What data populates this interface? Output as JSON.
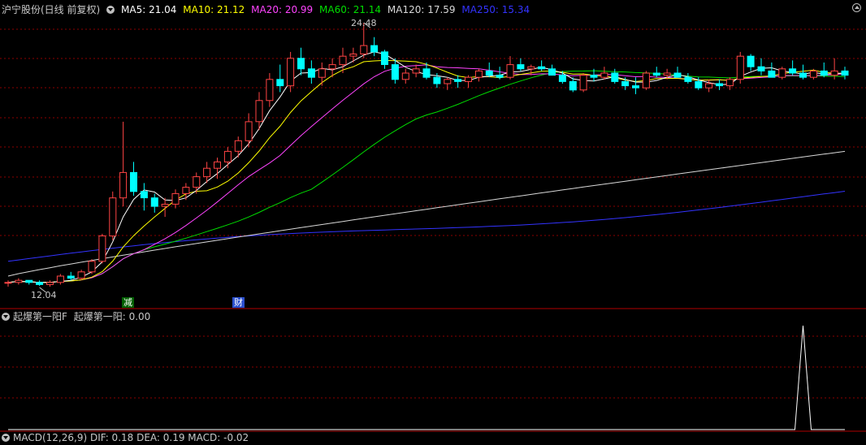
{
  "main_legend": {
    "title": "沪宁股份(日线 前复权)",
    "ma5": "MA5: 21.04",
    "ma10": "MA10: 21.12",
    "ma20": "MA20: 20.99",
    "ma60": "MA60: 21.14",
    "ma120": "MA120: 17.59",
    "ma250": "MA250: 15.34"
  },
  "colors": {
    "ma5": "#ffffff",
    "ma10": "#ffff00",
    "ma20": "#ff44ff",
    "ma60": "#00dd00",
    "ma120": "#d8d8d8",
    "ma250": "#3333ff",
    "up": "#ff4444",
    "down": "#00ffff",
    "grid": "#8b0000",
    "tag_green": "#00c000",
    "tag_blue": "#4a7bff"
  },
  "annotations": {
    "high": "24.48",
    "low": "12.04"
  },
  "event_tags": [
    "减",
    "财"
  ],
  "indicator_legend": {
    "name": "起爆第一阳F",
    "value": "起爆第一阳: 0.00"
  },
  "macd_legend": {
    "text": "MACD(12,26,9)  DIF: 0.18  DEA: 0.19  MACD: -0.02"
  },
  "chart_data": {
    "type": "candlestick",
    "price_range": [
      12.04,
      24.48
    ],
    "candles": [
      [
        12.2,
        12.3,
        12.0,
        12.2
      ],
      [
        12.2,
        12.4,
        12.1,
        12.3
      ],
      [
        12.3,
        12.3,
        12.1,
        12.2
      ],
      [
        12.2,
        12.3,
        12.04,
        12.1
      ],
      [
        12.1,
        12.3,
        12.0,
        12.2
      ],
      [
        12.2,
        12.6,
        12.1,
        12.5
      ],
      [
        12.5,
        12.7,
        12.3,
        12.4
      ],
      [
        12.4,
        12.8,
        12.3,
        12.7
      ],
      [
        12.7,
        13.3,
        12.6,
        13.2
      ],
      [
        13.2,
        14.5,
        13.1,
        14.4
      ],
      [
        14.4,
        16.5,
        14.2,
        16.2
      ],
      [
        16.2,
        19.8,
        15.8,
        17.4
      ],
      [
        17.4,
        17.9,
        16.3,
        16.5
      ],
      [
        16.5,
        16.9,
        15.6,
        16.2
      ],
      [
        16.2,
        16.4,
        15.5,
        15.8
      ],
      [
        15.8,
        16.2,
        15.3,
        15.9
      ],
      [
        15.9,
        16.6,
        15.7,
        16.4
      ],
      [
        16.4,
        16.9,
        16.1,
        16.7
      ],
      [
        16.7,
        17.4,
        16.4,
        17.2
      ],
      [
        17.2,
        17.9,
        16.9,
        17.6
      ],
      [
        17.6,
        18.1,
        17.1,
        17.9
      ],
      [
        17.9,
        18.6,
        17.6,
        18.4
      ],
      [
        18.4,
        19.1,
        18.1,
        18.9
      ],
      [
        18.9,
        20.2,
        18.6,
        19.8
      ],
      [
        19.8,
        21.2,
        19.4,
        20.8
      ],
      [
        20.8,
        22.1,
        20.5,
        21.8
      ],
      [
        21.8,
        22.5,
        21.2,
        21.5
      ],
      [
        21.5,
        23.1,
        21.2,
        22.8
      ],
      [
        22.8,
        23.3,
        22.0,
        22.3
      ],
      [
        22.3,
        22.7,
        21.6,
        21.9
      ],
      [
        21.9,
        22.6,
        21.5,
        22.3
      ],
      [
        22.3,
        22.8,
        21.9,
        22.5
      ],
      [
        22.5,
        23.3,
        22.1,
        22.9
      ],
      [
        22.9,
        23.3,
        22.6,
        23.0
      ],
      [
        23.0,
        24.48,
        22.8,
        23.4
      ],
      [
        23.4,
        23.8,
        22.9,
        23.1
      ],
      [
        23.1,
        23.2,
        22.3,
        22.5
      ],
      [
        22.5,
        22.8,
        21.6,
        21.8
      ],
      [
        21.8,
        22.3,
        21.6,
        22.1
      ],
      [
        22.1,
        22.5,
        21.9,
        22.3
      ],
      [
        22.3,
        22.6,
        21.8,
        21.9
      ],
      [
        21.9,
        22.1,
        21.4,
        21.6
      ],
      [
        21.6,
        21.9,
        21.3,
        21.8
      ],
      [
        21.8,
        22.0,
        21.4,
        21.7
      ],
      [
        21.7,
        22.0,
        21.4,
        21.9
      ],
      [
        21.9,
        22.3,
        21.7,
        22.2
      ],
      [
        22.2,
        22.6,
        21.9,
        22.0
      ],
      [
        22.0,
        22.4,
        21.8,
        21.9
      ],
      [
        21.9,
        22.9,
        21.8,
        22.5
      ],
      [
        22.5,
        22.8,
        22.2,
        22.3
      ],
      [
        22.3,
        22.5,
        22.0,
        22.4
      ],
      [
        22.4,
        22.7,
        22.2,
        22.3
      ],
      [
        22.3,
        22.5,
        22.0,
        22.0
      ],
      [
        22.0,
        22.2,
        21.6,
        21.7
      ],
      [
        21.7,
        21.9,
        21.2,
        21.3
      ],
      [
        21.3,
        22.1,
        21.2,
        22.0
      ],
      [
        22.0,
        22.3,
        21.7,
        21.9
      ],
      [
        21.9,
        22.4,
        21.8,
        22.1
      ],
      [
        22.1,
        22.3,
        21.6,
        21.7
      ],
      [
        21.7,
        21.9,
        21.3,
        21.5
      ],
      [
        21.5,
        21.9,
        21.1,
        21.4
      ],
      [
        21.4,
        22.2,
        21.3,
        22.1
      ],
      [
        22.1,
        22.4,
        21.9,
        22.0
      ],
      [
        22.0,
        22.3,
        21.8,
        22.1
      ],
      [
        22.1,
        22.4,
        21.9,
        21.9
      ],
      [
        21.9,
        22.1,
        21.6,
        21.7
      ],
      [
        21.7,
        21.9,
        21.3,
        21.4
      ],
      [
        21.4,
        21.8,
        21.2,
        21.6
      ],
      [
        21.6,
        21.8,
        21.3,
        21.5
      ],
      [
        21.5,
        21.9,
        21.3,
        21.8
      ],
      [
        21.8,
        23.1,
        21.6,
        22.9
      ],
      [
        22.9,
        23.0,
        22.2,
        22.4
      ],
      [
        22.4,
        22.8,
        22.0,
        22.2
      ],
      [
        22.2,
        22.6,
        21.9,
        21.9
      ],
      [
        21.9,
        22.4,
        21.8,
        22.3
      ],
      [
        22.3,
        22.7,
        22.0,
        22.1
      ],
      [
        22.1,
        22.5,
        21.8,
        21.9
      ],
      [
        21.9,
        22.3,
        21.8,
        22.2
      ],
      [
        22.2,
        22.6,
        21.9,
        22.0
      ],
      [
        22.0,
        22.8,
        21.8,
        22.2
      ],
      [
        22.2,
        22.4,
        21.8,
        22.0
      ]
    ],
    "indicator_signal_index": 76
  }
}
